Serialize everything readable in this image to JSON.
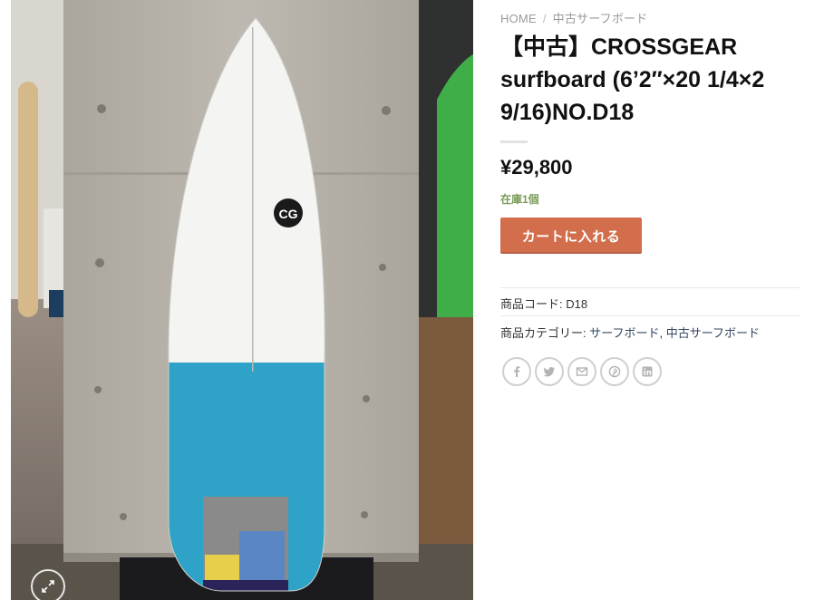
{
  "breadcrumb": {
    "home": "HOME",
    "separator": "/",
    "category": "中古サーフボード"
  },
  "product": {
    "title": "【中古】CROSSGEAR surfboard (6’2″×20 1/4×2 9/16)NO.D18",
    "price": "¥29,800",
    "stock": "在庫1個",
    "add_to_cart_label": "カートに入れる",
    "sku_label": "商品コード:",
    "sku_value": "D18",
    "categories_label": "商品カテゴリー:",
    "categories": [
      "サーフボード",
      "中古サーフボード"
    ],
    "category_separator": ","
  },
  "image": {
    "subject": "surfboard-photo",
    "board_logo_text": "CG",
    "zoom_icon": "expand-icon"
  },
  "share_icons": [
    "facebook-icon",
    "twitter-icon",
    "email-icon",
    "pinterest-icon",
    "linkedin-icon"
  ],
  "colors": {
    "cart_button": "#d26e4b",
    "stock_text": "#7a9c59",
    "link": "#334862",
    "board_tail": "#2fa3c7"
  }
}
